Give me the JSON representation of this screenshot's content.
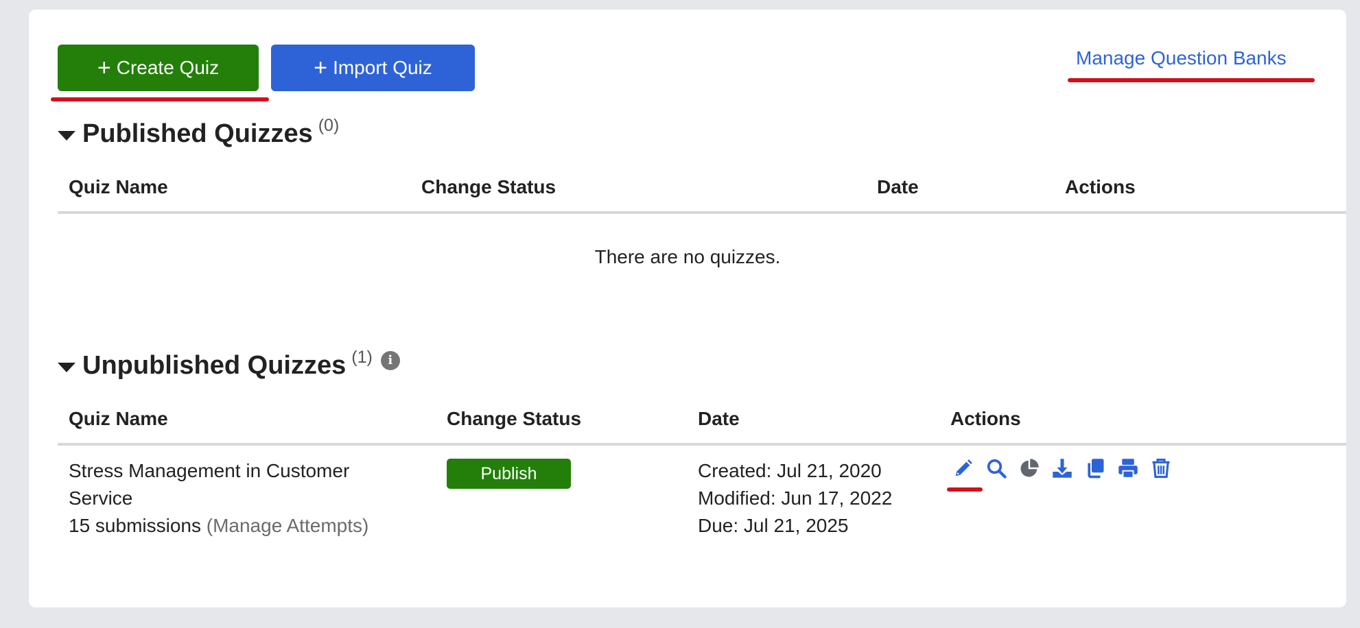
{
  "toolbar": {
    "create_label": "Create Quiz",
    "import_label": "Import Quiz",
    "manage_banks_label": "Manage Question Banks"
  },
  "published": {
    "title": "Published Quizzes",
    "count": "(0)",
    "headers": [
      "Quiz Name",
      "Change Status",
      "Date",
      "Actions"
    ],
    "empty_message": "There are no quizzes."
  },
  "unpublished": {
    "title": "Unpublished Quizzes",
    "count": "(1)",
    "info_icon": "info-icon",
    "headers": [
      "Quiz Name",
      "Change Status",
      "Date",
      "Actions"
    ],
    "rows": [
      {
        "name_line1": "Stress Management in Customer",
        "name_line2": "Service",
        "submissions": "15 submissions",
        "manage_attempts": "(Manage Attempts)",
        "status_button": "Publish",
        "created": "Created: Jul 21, 2020",
        "modified": "Modified: Jun 17, 2022",
        "due": "Due: Jul 21, 2025",
        "actions": [
          "pencil-icon",
          "search-icon",
          "pie-chart-icon",
          "download-icon",
          "copy-icon",
          "print-icon",
          "trash-icon"
        ]
      }
    ]
  },
  "colors": {
    "create_green": "#237f09",
    "import_blue": "#2e63d8",
    "highlight_red": "#d40f1c",
    "link_blue": "#2e63d8"
  }
}
